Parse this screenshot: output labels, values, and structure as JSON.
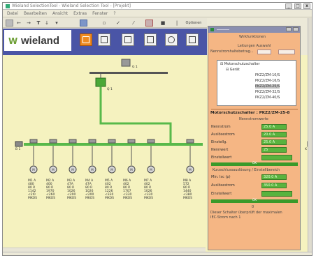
{
  "window": {
    "title": "Wieland SelectionTool - Wieland Selection Tool - [Projekt]",
    "menu": [
      "Datei",
      "Bearbeiten",
      "Ansicht",
      "Extras",
      "Fenster",
      "?"
    ],
    "close_label": "x"
  },
  "toolbar": {
    "panel_tab": "Optionen"
  },
  "brand": {
    "name": "wieland",
    "mark": "W"
  },
  "network": {
    "top_node_label": "G 1",
    "mid_node_label": "Q 1",
    "bus_left_label": "B 1",
    "bus_right_label": "K 1",
    "device_label": "",
    "devices": [
      {
        "tag": "M 1",
        "lines": "M1 A\n480\n80 R\n1142\n<2l0\nMKOS"
      },
      {
        "tag": "M 2",
        "lines": "M2 A\n400\n80 R\n1970\n<260\nMKOS"
      },
      {
        "tag": "M 3",
        "lines": "M3 A\n47A\n80 R\n1026\n<200\nMKOS"
      },
      {
        "tag": "M 4",
        "lines": "M4 A\n47A\n80 R\n1026\n<200\nMKOS"
      },
      {
        "tag": "M 5",
        "lines": "M5 A\n402\n80 R\n1226\n<330\nMKOS"
      },
      {
        "tag": "M 6",
        "lines": "M6 A\n402\n80 R\n1707\n<330\nMKOS"
      },
      {
        "tag": "M 7",
        "lines": "M7 A\n402\n80 R\n1026\n<330\nMKOS"
      },
      {
        "tag": "M 8",
        "lines": "M8 A\n572\n80 R\n1440\n<380\nMKOS"
      }
    ]
  },
  "panel": {
    "header": "Wirkfunktionen",
    "subheader": "Leitungen Auswahl",
    "field_label": "Nennstromhaltebetrag...",
    "tree": [
      "Motorschutzschalter",
      "Gerät",
      "PKZ2/ZM-10/S",
      "PKZ2/ZM-16/S",
      "PKZ2/ZM-25/S",
      "PKZ2/ZM-32/S",
      "PKZ2/ZM-40/S"
    ],
    "selected_index": 4,
    "section_title": "Motorschutzschalter : PKZ2/ZM-25-8",
    "section_sub": "Nennstromwerte",
    "rows": [
      {
        "label": "Nennstrom",
        "value": "25.0 A"
      },
      {
        "label": "Auslösestrom",
        "value": "20.0 A"
      },
      {
        "label": "Einstellg.",
        "value": "25.0 A"
      },
      {
        "label": "Nennwert",
        "value": "25"
      },
      {
        "label": "Einstellwert",
        "value": ""
      }
    ],
    "bar1": "OK",
    "section2_title": "Kurzschlussauslösung / Einstellbereich",
    "rows2": [
      {
        "label": "Min. Isc (p)",
        "value": "320.0 A"
      },
      {
        "label": "Auslösestrom",
        "value": "350.0 A"
      },
      {
        "label": "Einstellwert",
        "value": ""
      }
    ],
    "bar2": "OK",
    "footer_num": "0",
    "footer_text_1": "Dieser Schalter überprüft der maximalen",
    "footer_text_2": "IEC-Strom nach 1"
  }
}
